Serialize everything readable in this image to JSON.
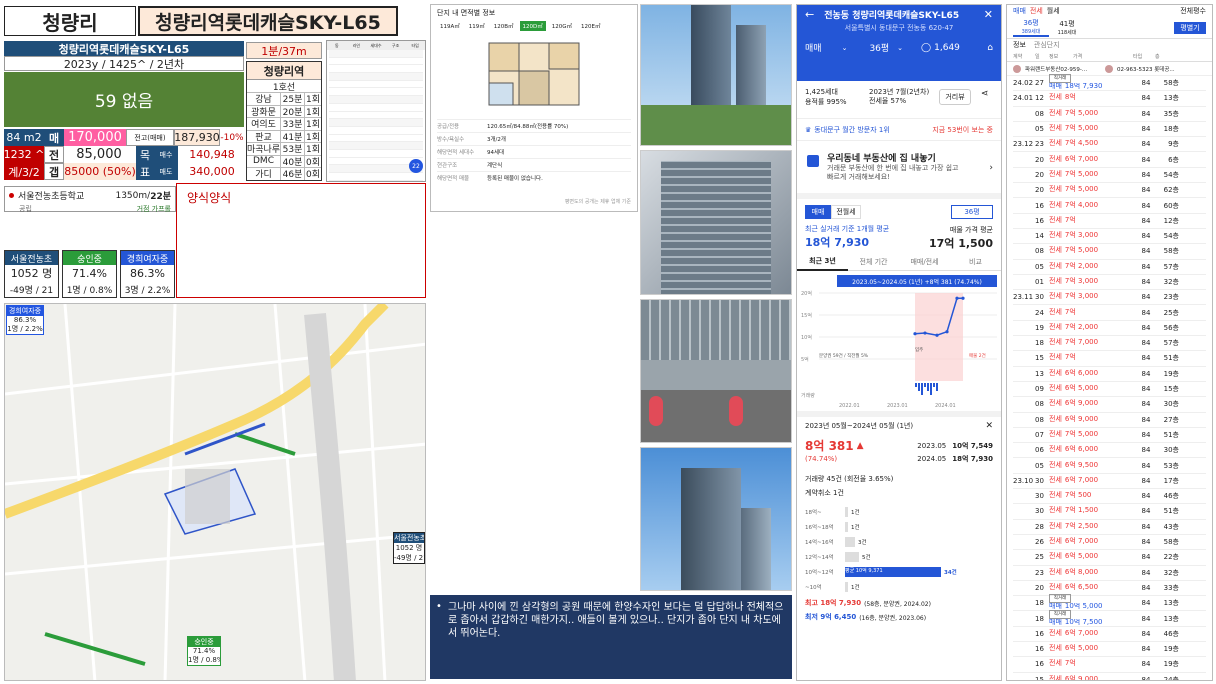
{
  "header": {
    "district": "청량리",
    "title": "청량리역롯데캐슬SKY-L65"
  },
  "summary": {
    "name": "청량리역롯데캐슬SKY-L65",
    "year_info": "2023y / 1425^ / 2년차",
    "main_value": "59 없음",
    "commute": "1분/37m",
    "area": "84 m2",
    "sale_label": "매",
    "sale_price": "170,000",
    "units": "1232 ^",
    "jeonse_label": "전",
    "jeonse_price": "85,000",
    "rooms": "계/3/2",
    "gap_label": "갭",
    "gap_value": "85000 (50%)",
    "max_label": "전고(매매)",
    "max_price": "187,930",
    "max_pct": "-10%",
    "target_label": "목",
    "rent_label": "매수",
    "rent_price": "140,948",
    "pyo_label": "표",
    "sell_label": "매도",
    "sell_price": "340,000"
  },
  "commute_table": {
    "header": "청량리역",
    "sub": "1호선",
    "rows": [
      {
        "dest": "강남",
        "time": "25분",
        "transfer": "1회"
      },
      {
        "dest": "광화문",
        "time": "20분",
        "transfer": "1회"
      },
      {
        "dest": "여의도",
        "time": "33분",
        "transfer": "1회"
      },
      {
        "dest": "판교",
        "time": "41분",
        "transfer": "1회"
      },
      {
        "dest": "마곡나루",
        "time": "53분",
        "transfer": "1회"
      },
      {
        "dest": "DMC",
        "time": "40분",
        "transfer": "0회"
      },
      {
        "dest": "가디",
        "time": "46분",
        "transfer": "0회"
      }
    ]
  },
  "school": {
    "name": "서울전농초등학교",
    "dist": "1350m/",
    "students": "22분",
    "sub": "공립",
    "note": "거점 가프롤"
  },
  "note_box": "양식양식",
  "schools": [
    {
      "name": "서울전농초",
      "v1": "1052 명",
      "v2": "-49명 / 21"
    },
    {
      "name": "숭인중",
      "v1": "71.4%",
      "v2": "1명 / 0.8%"
    },
    {
      "name": "경희여자중",
      "v1": "86.3%",
      "v2": "3명 / 2.2%"
    }
  ],
  "map": {
    "labels": [
      {
        "name": "경희여자중",
        "v1": "86.3%",
        "v2": "1명 / 2.2%"
      },
      {
        "name": "서울전농초",
        "v1": "1052 명",
        "v2": "-49명 / 21"
      },
      {
        "name": "숭인중",
        "v1": "71.4%",
        "v2": "1명 / 0.8%"
      }
    ]
  },
  "floorplan": {
    "title": "단지 내 면적별 정보",
    "tabs": [
      "119A㎡",
      "119㎡",
      "120B㎡",
      "120D㎡",
      "120G㎡",
      "120E㎡"
    ],
    "info": [
      {
        "k": "공급/전용",
        "v": "120.65㎡/84.88㎡(전용률 70%)"
      },
      {
        "k": "방수/욕실수",
        "v": "3개/2개"
      },
      {
        "k": "해당면적 세대수",
        "v": "94세대"
      },
      {
        "k": "현관구조",
        "v": "계단식"
      },
      {
        "k": "해당면적 매물",
        "v": "등록된 매물이 없습니다."
      }
    ],
    "footer": "평면도의 공개는 제휴 업체 기준"
  },
  "table_mini": {
    "headers": [
      "동",
      "라인",
      "세대수",
      "구조",
      "타입"
    ]
  },
  "commentary": "그나마 사이에 낀 삼각형의 공원 때문에 한양수자인 보다는 덜 답답하나 전체적으로 좁아서 갑갑하긴 매한가지.. 애들이 볼게 있으나.. 단지가 좁아 단지 내 차도에서 뛰어논다.",
  "mobile": {
    "title": "전농동 청량리역롯데캐슬SKY-L65",
    "address": "서울특별시 동대문구 전농동 620-47",
    "tab_sale": "매매",
    "tab_size": "36평",
    "likes": "1,649",
    "households": "1,425세대",
    "date": "2023년 7월(2년차)",
    "floor_ratio": "용적률 995%",
    "jeonse_ratio": "전세율 57%",
    "btn_view": "거리뷰",
    "rank": "동대문구 월간 방문자 1위",
    "rank_link": "지금 53번이 보는 중",
    "promo_title": "우리동네 부동산에 집 내놓기",
    "promo_sub": "거래문 부동산에 한 번에 집 내놓고 가장 쉽고 빠르게 거래해보세요!",
    "seg": [
      "매매",
      "전월세"
    ],
    "seg_size": "36평",
    "avg_label": "최근 실거래 기준 1개월 평균",
    "avg_price": "18억 7,930",
    "ask_label": "매물 가격 평균",
    "ask_price": "17억 1,500",
    "periods": [
      "최근 3년",
      "전체 기간",
      "매매/전세",
      "비교"
    ],
    "chart_banner": "2023.05~2024.05 (1년) +8억 381 (74.74%)",
    "range": "2023년 05월~2024년 05월 (1년)",
    "change": "8억 381",
    "change_pct": "(74.74%)",
    "p1_date": "2023.05",
    "p1_val": "10억 7,549",
    "p2_date": "2024.05",
    "p2_val": "18억 7,930",
    "volume": "거래량 45건 (회전율 3.65%)",
    "cancel": "계약취소 1건",
    "hist": [
      {
        "label": "18억~",
        "count": "1건"
      },
      {
        "label": "16억~18억",
        "count": "1건"
      },
      {
        "label": "14억~16억",
        "count": "3건"
      },
      {
        "label": "12억~14억",
        "count": "5건"
      },
      {
        "label": "10억~12억",
        "count": "34건",
        "note": "평균 10억 9,371"
      },
      {
        "label": "~10억",
        "count": "1건"
      }
    ],
    "hi": "최고 18억 7,930",
    "hi_note": "(58층, 분양권, 2024.02)",
    "lo": "최저 9억 6,450",
    "lo_note": "(16층, 분양권, 2023.06)"
  },
  "chart_data": {
    "type": "line",
    "title": "",
    "ylim": [
      0,
      20
    ],
    "yticks": [
      "20억",
      "15억",
      "10억",
      "5억",
      "거래량"
    ],
    "xticks": [
      "2022.01",
      "2023.01",
      "2024.01"
    ],
    "series": [
      {
        "name": "매매",
        "x": [
          "2023.05",
          "2023.08",
          "2023.11",
          "2024.01",
          "2024.02",
          "2024.05"
        ],
        "values": [
          10.75,
          10.9,
          10.4,
          11.2,
          18.8,
          18.8
        ]
      }
    ],
    "labels": [
      "분양권 59건 / 직전월 5%",
      "입주",
      "매물 2건"
    ]
  },
  "dealtable": {
    "tabs": [
      "매매",
      "전세",
      "월세"
    ],
    "filter": "전체평수",
    "size1": "36평",
    "size1b": "389세대",
    "size2": "41평",
    "size2b": "118세대",
    "button": "평별기",
    "info": "정보",
    "myfilter": "관심단지",
    "headers": [
      "계약",
      "일",
      "정보",
      "가격",
      "타입",
      "층"
    ],
    "agent": "파워랜드부동산02-959-...",
    "agent_phone": "02-963-5323 롯데공...",
    "rows": [
      {
        "ym": "24.02",
        "d": "27",
        "type": "매매",
        "price": "18억 7,930",
        "area": "84",
        "fl": "58층",
        "badge": "직거래"
      },
      {
        "ym": "24.01",
        "d": "12",
        "type": "전세",
        "price": "8억",
        "area": "84",
        "fl": "13층"
      },
      {
        "ym": "",
        "d": "08",
        "type": "전세",
        "price": "7억 5,000",
        "area": "84",
        "fl": "35층"
      },
      {
        "ym": "",
        "d": "05",
        "type": "전세",
        "price": "7억 5,000",
        "area": "84",
        "fl": "18층"
      },
      {
        "ym": "23.12",
        "d": "23",
        "type": "전세",
        "price": "7억 4,500",
        "area": "84",
        "fl": "9층"
      },
      {
        "ym": "",
        "d": "20",
        "type": "전세",
        "price": "6억 7,000",
        "area": "84",
        "fl": "6층"
      },
      {
        "ym": "",
        "d": "20",
        "type": "전세",
        "price": "7억 5,000",
        "area": "84",
        "fl": "54층"
      },
      {
        "ym": "",
        "d": "20",
        "type": "전세",
        "price": "7억 5,000",
        "area": "84",
        "fl": "62층"
      },
      {
        "ym": "",
        "d": "16",
        "type": "전세",
        "price": "7억 4,000",
        "area": "84",
        "fl": "60층"
      },
      {
        "ym": "",
        "d": "16",
        "type": "전세",
        "price": "7억",
        "area": "84",
        "fl": "12층"
      },
      {
        "ym": "",
        "d": "14",
        "type": "전세",
        "price": "7억 3,000",
        "area": "84",
        "fl": "54층"
      },
      {
        "ym": "",
        "d": "08",
        "type": "전세",
        "price": "7억 5,000",
        "area": "84",
        "fl": "58층"
      },
      {
        "ym": "",
        "d": "05",
        "type": "전세",
        "price": "7억 2,000",
        "area": "84",
        "fl": "57층"
      },
      {
        "ym": "",
        "d": "01",
        "type": "전세",
        "price": "7억 3,000",
        "area": "84",
        "fl": "32층"
      },
      {
        "ym": "23.11",
        "d": "30",
        "type": "전세",
        "price": "7억 3,000",
        "area": "84",
        "fl": "23층"
      },
      {
        "ym": "",
        "d": "24",
        "type": "전세",
        "price": "7억",
        "area": "84",
        "fl": "25층"
      },
      {
        "ym": "",
        "d": "19",
        "type": "전세",
        "price": "7억 2,000",
        "area": "84",
        "fl": "56층"
      },
      {
        "ym": "",
        "d": "18",
        "type": "전세",
        "price": "7억 7,000",
        "area": "84",
        "fl": "57층"
      },
      {
        "ym": "",
        "d": "15",
        "type": "전세",
        "price": "7억",
        "area": "84",
        "fl": "51층"
      },
      {
        "ym": "",
        "d": "13",
        "type": "전세",
        "price": "6억 6,000",
        "area": "84",
        "fl": "19층"
      },
      {
        "ym": "",
        "d": "09",
        "type": "전세",
        "price": "6억 5,000",
        "area": "84",
        "fl": "15층"
      },
      {
        "ym": "",
        "d": "08",
        "type": "전세",
        "price": "6억 9,000",
        "area": "84",
        "fl": "30층"
      },
      {
        "ym": "",
        "d": "08",
        "type": "전세",
        "price": "6억 9,000",
        "area": "84",
        "fl": "27층"
      },
      {
        "ym": "",
        "d": "07",
        "type": "전세",
        "price": "7억 5,000",
        "area": "84",
        "fl": "51층"
      },
      {
        "ym": "",
        "d": "06",
        "type": "전세",
        "price": "6억 6,000",
        "area": "84",
        "fl": "30층"
      },
      {
        "ym": "",
        "d": "05",
        "type": "전세",
        "price": "6억 9,500",
        "area": "84",
        "fl": "53층"
      },
      {
        "ym": "23.10",
        "d": "30",
        "type": "전세",
        "price": "6억 7,000",
        "area": "84",
        "fl": "17층"
      },
      {
        "ym": "",
        "d": "30",
        "type": "전세",
        "price": "7억 500",
        "area": "84",
        "fl": "46층"
      },
      {
        "ym": "",
        "d": "30",
        "type": "전세",
        "price": "7억 1,500",
        "area": "84",
        "fl": "51층"
      },
      {
        "ym": "",
        "d": "28",
        "type": "전세",
        "price": "7억 2,500",
        "area": "84",
        "fl": "43층"
      },
      {
        "ym": "",
        "d": "26",
        "type": "전세",
        "price": "6억 7,000",
        "area": "84",
        "fl": "58층"
      },
      {
        "ym": "",
        "d": "25",
        "type": "전세",
        "price": "6억 5,000",
        "area": "84",
        "fl": "22층"
      },
      {
        "ym": "",
        "d": "23",
        "type": "전세",
        "price": "6억 8,000",
        "area": "84",
        "fl": "32층"
      },
      {
        "ym": "",
        "d": "20",
        "type": "전세",
        "price": "6억 6,500",
        "area": "84",
        "fl": "33층"
      },
      {
        "ym": "",
        "d": "18",
        "type": "매매",
        "price": "10억 5,000",
        "area": "84",
        "fl": "13층",
        "badge": "직거래"
      },
      {
        "ym": "",
        "d": "18",
        "type": "매매",
        "price": "10억 7,500",
        "area": "84",
        "fl": "13층",
        "badge": "직거래"
      },
      {
        "ym": "",
        "d": "16",
        "type": "전세",
        "price": "6억 7,000",
        "area": "84",
        "fl": "46층"
      },
      {
        "ym": "",
        "d": "16",
        "type": "전세",
        "price": "6억 5,000",
        "area": "84",
        "fl": "19층"
      },
      {
        "ym": "",
        "d": "16",
        "type": "전세",
        "price": "7억",
        "area": "84",
        "fl": "19층"
      },
      {
        "ym": "",
        "d": "15",
        "type": "전세",
        "price": "6억 9,000",
        "area": "84",
        "fl": "24층"
      }
    ]
  },
  "colors": {
    "accent_blue": "#1f73c6",
    "green": "#548235",
    "pink": "#ffc7ce",
    "darkblue": "#203864",
    "red": "#e53935"
  }
}
